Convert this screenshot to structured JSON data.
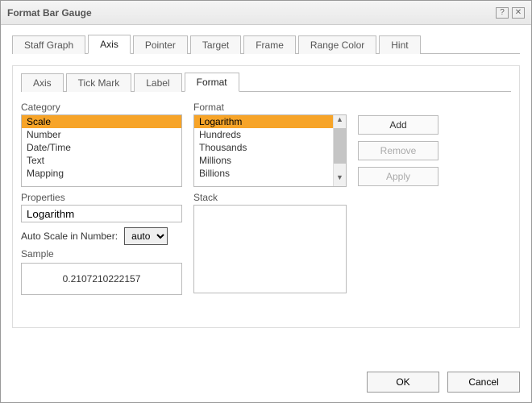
{
  "dialog": {
    "title": "Format Bar Gauge"
  },
  "outer_tabs": {
    "t0": "Staff Graph",
    "t1": "Axis",
    "t2": "Pointer",
    "t3": "Target",
    "t4": "Frame",
    "t5": "Range Color",
    "t6": "Hint"
  },
  "inner_tabs": {
    "t0": "Axis",
    "t1": "Tick Mark",
    "t2": "Label",
    "t3": "Format"
  },
  "labels": {
    "category": "Category",
    "format": "Format",
    "properties": "Properties",
    "auto_scale": "Auto Scale in Number:",
    "sample": "Sample",
    "stack": "Stack"
  },
  "category_items": {
    "i0": "Scale",
    "i1": "Number",
    "i2": "Date/Time",
    "i3": "Text",
    "i4": "Mapping"
  },
  "format_items": {
    "i0": "Logarithm",
    "i1": "Hundreds",
    "i2": "Thousands",
    "i3": "Millions",
    "i4": "Billions"
  },
  "properties_value": "Logarithm",
  "auto_scale_options": {
    "o0": "auto"
  },
  "auto_scale_selected": "auto",
  "sample_value": "0.2107210222157",
  "buttons": {
    "add": "Add",
    "remove": "Remove",
    "apply": "Apply",
    "ok": "OK",
    "cancel": "Cancel"
  },
  "icons": {
    "help": "?",
    "close": "✕",
    "scroll_up": "▲",
    "scroll_down": "▼"
  }
}
